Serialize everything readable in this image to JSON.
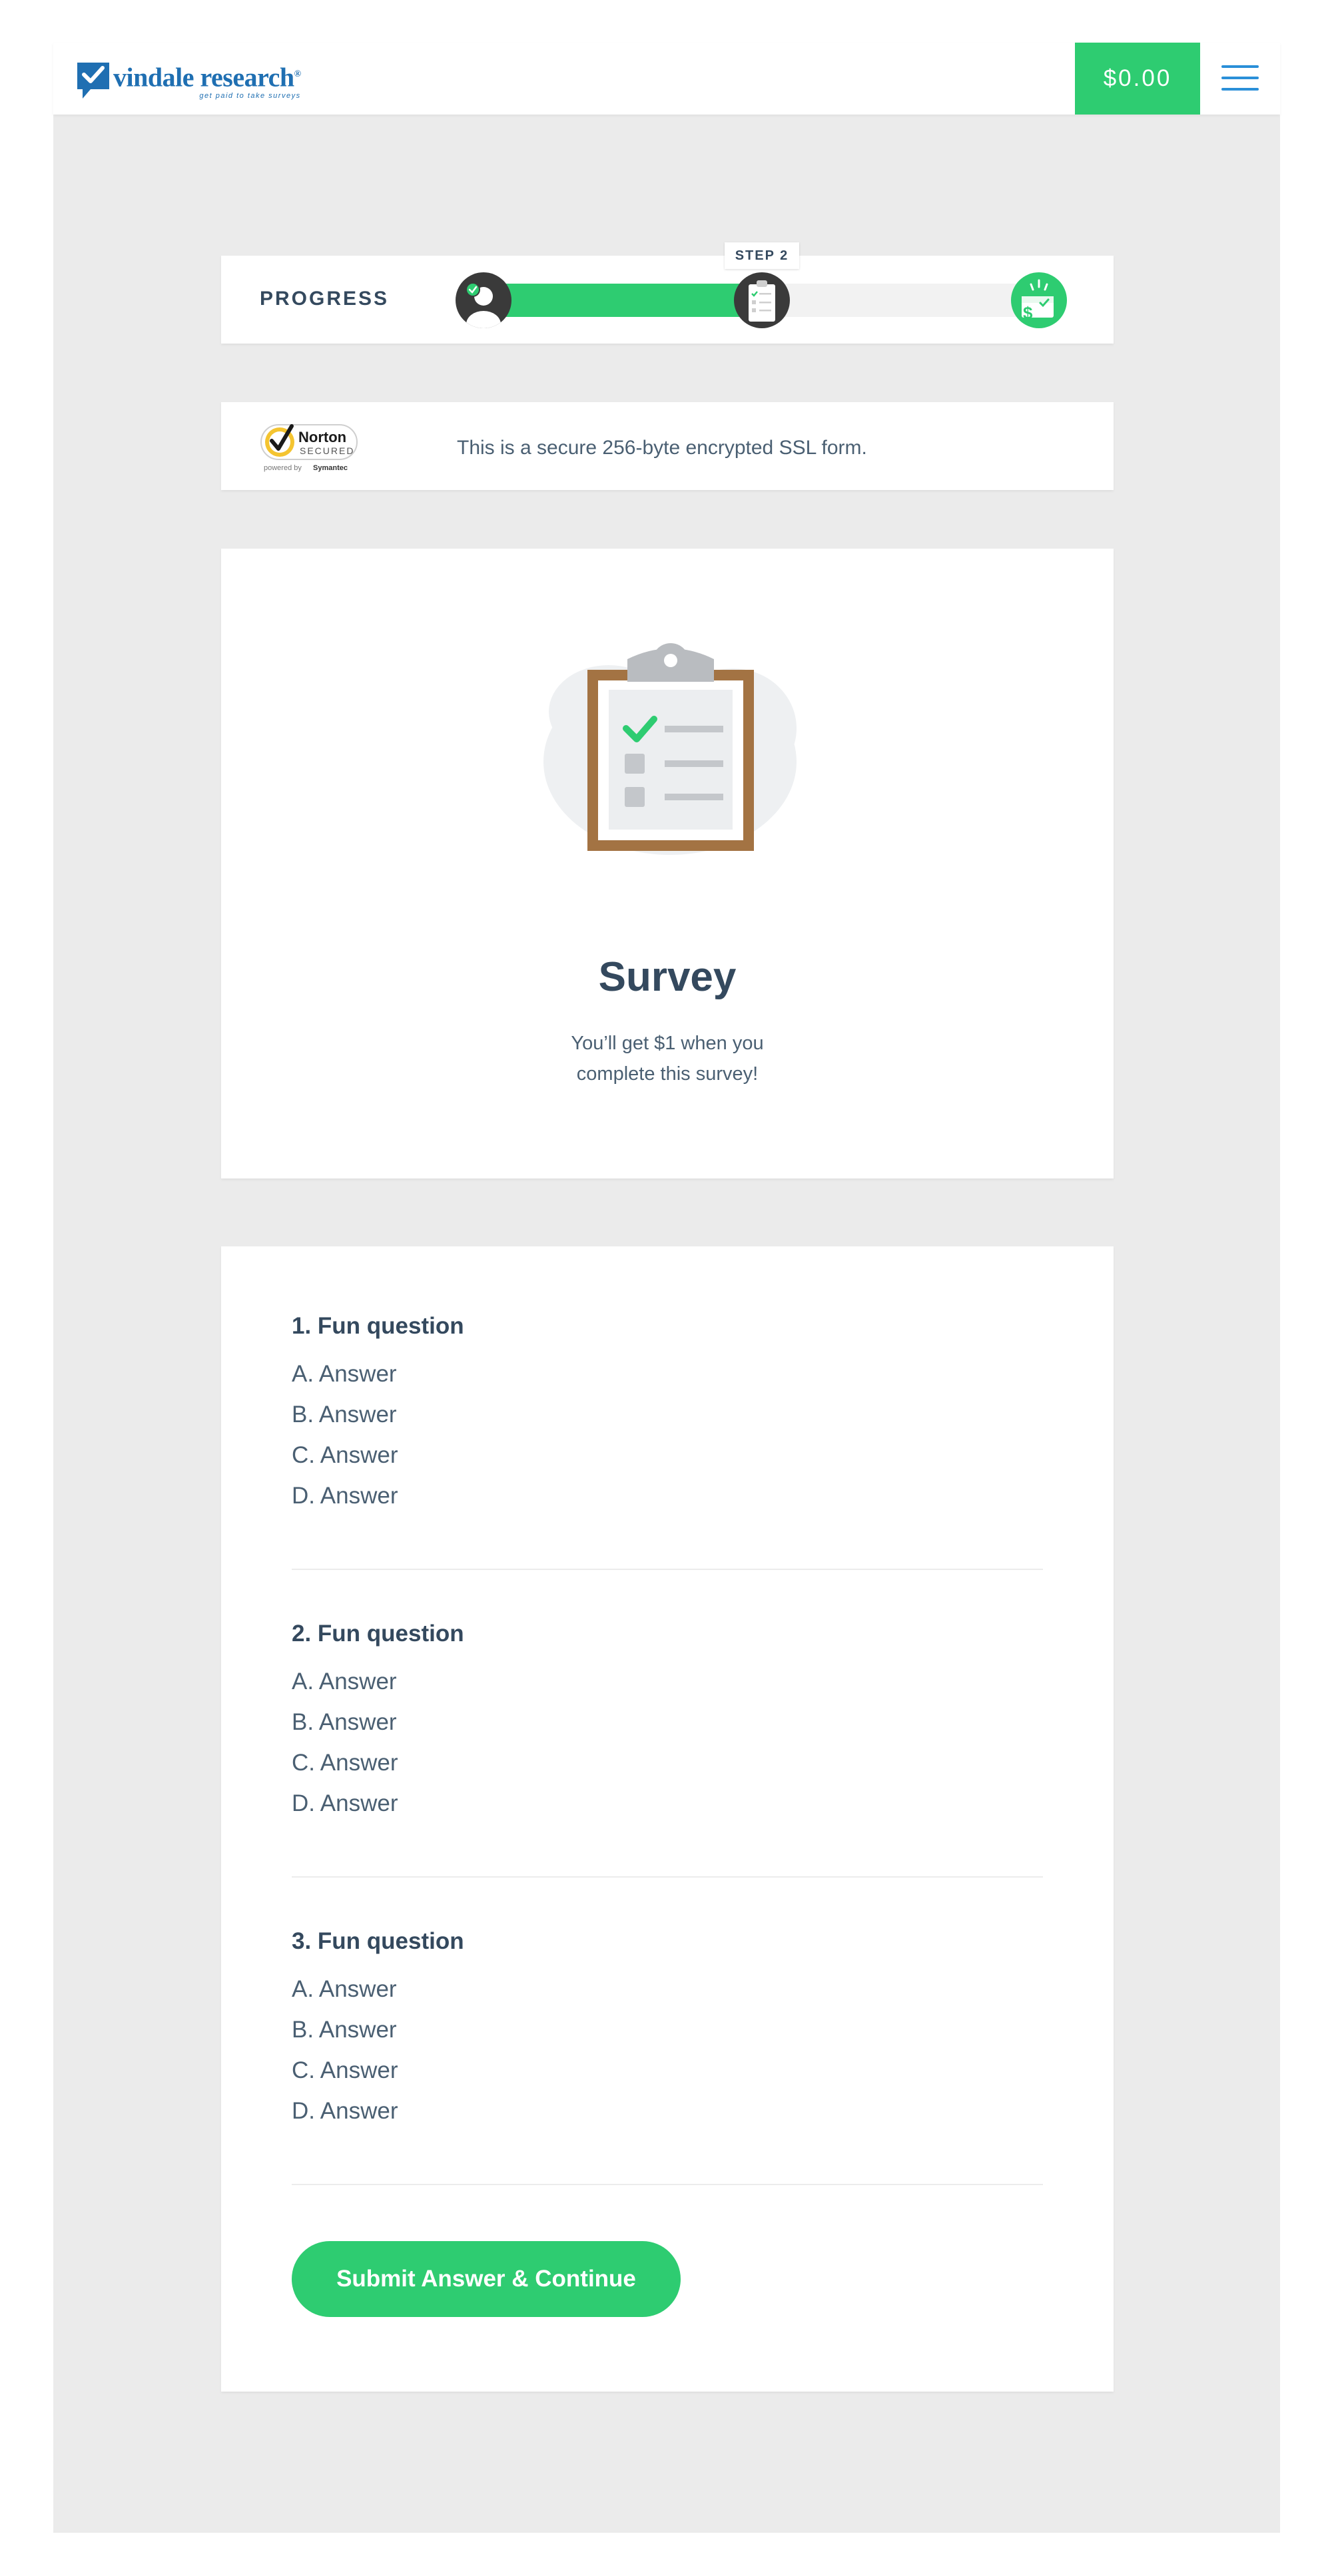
{
  "header": {
    "brand_name": "vindale research",
    "brand_registered": "®",
    "brand_tagline": "get paid to take surveys",
    "balance": "$0.00",
    "menu_icon": "hamburger-icon",
    "brand_color": "#1f6fb2",
    "accent_color": "#2ecc71"
  },
  "progress": {
    "label": "PROGRESS",
    "step_tag": "STEP 2",
    "completed_fraction": 0.5,
    "steps": [
      {
        "icon": "user-check-icon",
        "state": "complete"
      },
      {
        "icon": "clipboard-icon",
        "state": "current"
      },
      {
        "icon": "money-reward-icon",
        "state": "upcoming"
      }
    ]
  },
  "security": {
    "badge_title": "Norton",
    "badge_sub": "SECURED",
    "badge_powered_prefix": "powered by",
    "badge_powered_brand": "Symantec",
    "text": "This is a secure 256-byte encrypted SSL form."
  },
  "survey": {
    "title": "Survey",
    "subtitle_line1": "You’ll get $1 when you",
    "subtitle_line2": "complete this survey!"
  },
  "questions": [
    {
      "title": "1. Fun question",
      "answers": [
        "A. Answer",
        "B. Answer",
        "C. Answer",
        "D. Answer"
      ]
    },
    {
      "title": "2. Fun question",
      "answers": [
        "A. Answer",
        "B. Answer",
        "C. Answer",
        "D. Answer"
      ]
    },
    {
      "title": "3. Fun question",
      "answers": [
        "A. Answer",
        "B. Answer",
        "C. Answer",
        "D. Answer"
      ]
    }
  ],
  "submit_label": "Submit Answer & Continue"
}
